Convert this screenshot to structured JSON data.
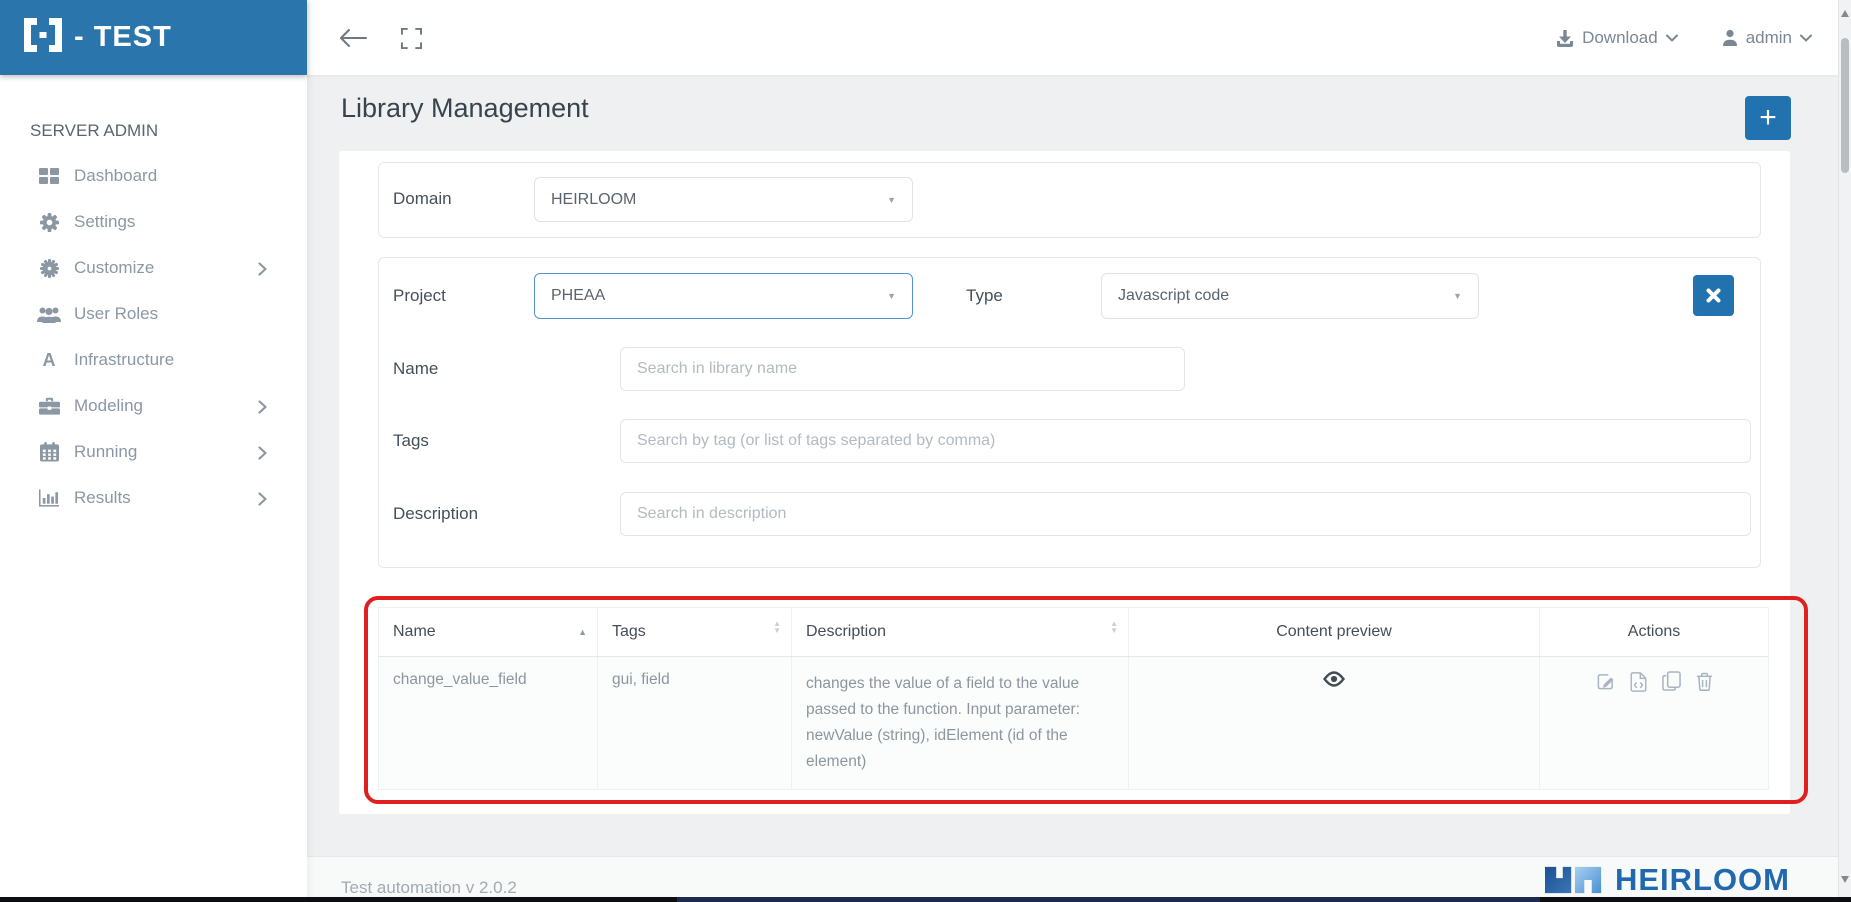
{
  "brand": {
    "suffix": "- TEST"
  },
  "topbar": {
    "download_label": "Download",
    "user_label": "admin"
  },
  "sidebar": {
    "section_title": "SERVER ADMIN",
    "items": [
      {
        "label": "Dashboard"
      },
      {
        "label": "Settings"
      },
      {
        "label": "Customize"
      },
      {
        "label": "User Roles"
      },
      {
        "label": "Infrastructure"
      },
      {
        "label": "Modeling"
      },
      {
        "label": "Running"
      },
      {
        "label": "Results"
      }
    ]
  },
  "page": {
    "title": "Library Management",
    "add_button_label": "+"
  },
  "filters": {
    "domain": {
      "label": "Domain",
      "value": "HEIRLOOM"
    },
    "project": {
      "label": "Project",
      "value": "PHEAA"
    },
    "type": {
      "label": "Type",
      "value": "Javascript code"
    },
    "name": {
      "label": "Name",
      "placeholder": "Search in library name"
    },
    "tags": {
      "label": "Tags",
      "placeholder": "Search by tag (or list of tags separated by comma)"
    },
    "description": {
      "label": "Description",
      "placeholder": "Search in description"
    }
  },
  "table": {
    "columns": [
      "Name",
      "Tags",
      "Description",
      "Content preview",
      "Actions"
    ],
    "rows": [
      {
        "name": "change_value_field",
        "tags": "gui, field",
        "description": "changes the value of a field to the value passed to the function. Input parameter: newValue (string), idElement (id of the element)"
      }
    ]
  },
  "footer": {
    "version": "Test automation v 2.0.2",
    "brand": "HEIRLOOM"
  },
  "icons": {
    "caret": "▼",
    "sort_asc": "▲",
    "sort_desc": "▼"
  },
  "colors": {
    "brand_blue": "#2a76ac",
    "accent_blue": "#2272b0",
    "annotation_red": "#e01f1f"
  }
}
